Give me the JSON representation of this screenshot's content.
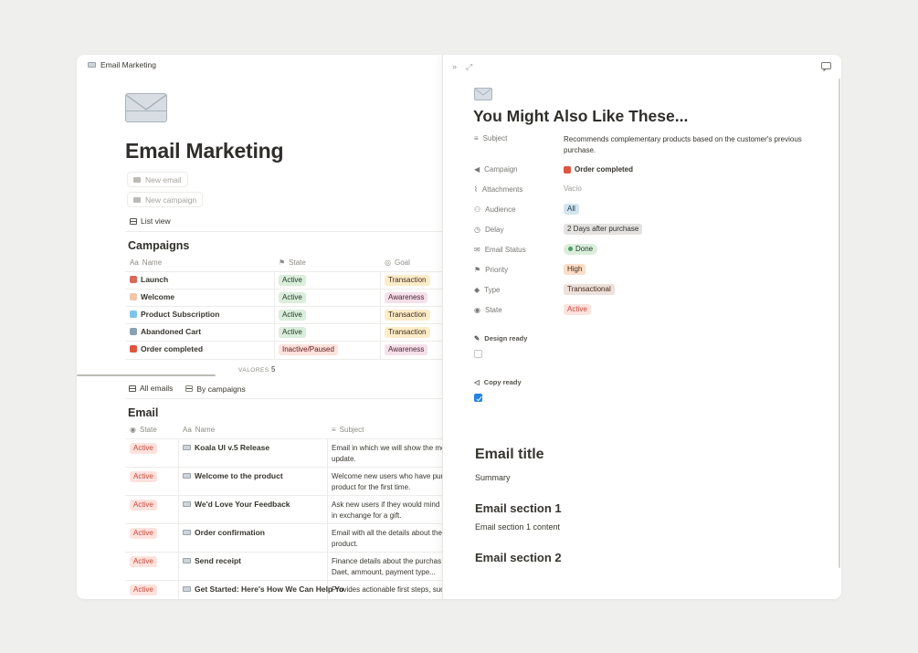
{
  "colors": {
    "background": "#efefee",
    "accent": "#2383e2"
  },
  "breadcrumb": {
    "icon": "envelope-icon",
    "title": "Email Marketing"
  },
  "page": {
    "title": "Email Marketing",
    "icon": "envelope-icon"
  },
  "buttons": {
    "new_email": "New email",
    "new_campaign": "New campaign"
  },
  "views": {
    "list_view": "List view"
  },
  "campaigns": {
    "title": "Campaigns",
    "columns": [
      "Name",
      "State",
      "Goal"
    ],
    "column_prefix": "Aa",
    "rows": [
      {
        "name": "Launch",
        "icon": "rocket-icon",
        "state": "Active",
        "goal": "Transaction"
      },
      {
        "name": "Welcome",
        "icon": "sparkles-icon",
        "state": "Active",
        "goal": "Awareness"
      },
      {
        "name": "Product Subscription",
        "icon": "gem-icon",
        "state": "Active",
        "goal": "Transaction"
      },
      {
        "name": "Abandoned Cart",
        "icon": "cart-icon",
        "state": "Active",
        "goal": "Transaction"
      },
      {
        "name": "Order completed",
        "icon": "party-popper-icon",
        "state": "Inactive/Paused",
        "goal": "Awareness"
      }
    ],
    "valores_label": "VALORES",
    "valores_count": "5"
  },
  "email_tabs": {
    "all": "All emails",
    "by_campaign": "By campaigns"
  },
  "emails": {
    "title": "Email",
    "columns": [
      "State",
      "Name",
      "Subject"
    ],
    "column_prefix": "Aa",
    "rows": [
      {
        "state": "Active",
        "name": "Koala UI v.5 Release",
        "subject1": "Email in which we will show the mo",
        "subject2": "update."
      },
      {
        "state": "Active",
        "name": "Welcome to the product",
        "subject1": "Welcome new users who have pur",
        "subject2": "product for the first time."
      },
      {
        "state": "Active",
        "name": "We'd Love Your Feedback",
        "subject1": "Ask new users if they would mind",
        "subject2": "in exchange for a gift."
      },
      {
        "state": "Active",
        "name": "Order confirmation",
        "subject1": "Email with all the details about the",
        "subject2": "product."
      },
      {
        "state": "Active",
        "name": "Send receipt",
        "subject1": "Finance details about the purchas",
        "subject2": "Daet, ammount, payment type..."
      },
      {
        "state": "Active",
        "name": "Get Started: Here's How We Can Help Yo",
        "subject1": "Provides actionable first steps, suc",
        "subject2": ""
      }
    ]
  },
  "detail": {
    "title": "You Might Also Like These...",
    "icon": "envelope-icon",
    "properties": {
      "subject_label": "Subject",
      "subject_value1": "Recommends complementary products based on the customer's previous",
      "subject_value2": "purchase.",
      "campaign_label": "Campaign",
      "campaign_value": "Order completed",
      "attachments_label": "Attachments",
      "attachments_value": "Vacío",
      "audience_label": "Audience",
      "audience_value": "All",
      "delay_label": "Delay",
      "delay_value": "2 Days after purchase",
      "email_status_label": "Email Status",
      "email_status_value": "Done",
      "priority_label": "Priority",
      "priority_value": "High",
      "type_label": "Type",
      "type_value": "Transactional",
      "state_label": "State",
      "state_value": "Active"
    },
    "design_ready": {
      "label": "Design ready",
      "checked": false
    },
    "copy_ready": {
      "label": "Copy ready",
      "checked": true
    },
    "body": {
      "email_title": "Email title",
      "summary": "Summary",
      "section1": "Email section 1",
      "section1_content": "Email section 1 content",
      "section2": "Email section 2"
    }
  }
}
